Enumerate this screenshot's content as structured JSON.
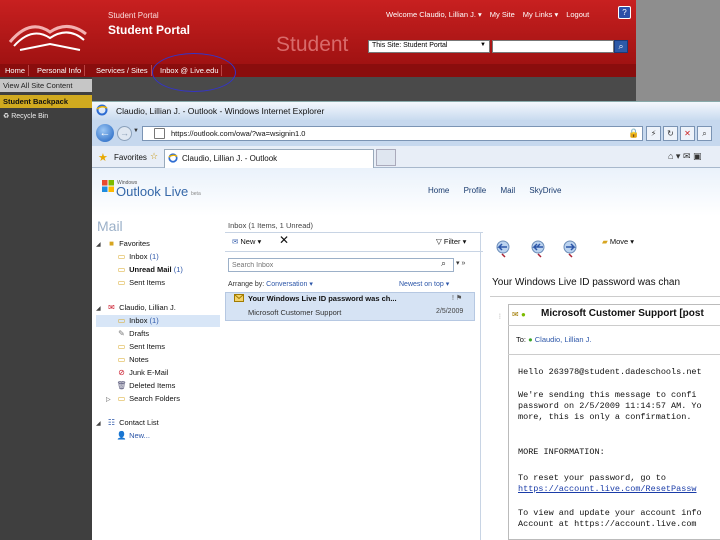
{
  "portal": {
    "small_title": "Student Portal",
    "title": "Student Portal",
    "watermark": "Student",
    "welcome": "Welcome Claudio, Lillian J. ▾",
    "my_site": "My Site",
    "my_links": "My Links ▾",
    "logout": "Logout",
    "help": "?",
    "site_select": "This Site: Student Portal",
    "nav": [
      "Home",
      "Personal Info",
      "Services / Sites",
      "Inbox @ Live.edu"
    ],
    "view_all": "View All Site Content",
    "backpack": "Student Backpack",
    "recycle": "Recycle Bin"
  },
  "ie": {
    "window_title": "Claudio, Lillian J. - Outlook - Windows Internet Explorer",
    "address": "https://outlook.com/owa/?wa=wsignin1.0",
    "favorites": "Favorites",
    "tab_title": "Claudio, Lillian J. - Outlook"
  },
  "outlook": {
    "logo_msn": "Windows",
    "logo_text": "Outlook Live",
    "logo_beta": "beta",
    "nav": [
      "Home",
      "Profile",
      "Mail",
      "SkyDrive"
    ],
    "mail_heading": "Mail",
    "folders": {
      "favorites": "Favorites",
      "fav_inbox": "Inbox",
      "fav_inbox_count": "(1)",
      "unread_mail": "Unread Mail",
      "unread_count": "(1)",
      "sent_items_fav": "Sent Items",
      "account": "Claudio, Lillian J.",
      "inbox": "Inbox",
      "inbox_count": "(1)",
      "drafts": "Drafts",
      "sent_items": "Sent Items",
      "notes": "Notes",
      "junk": "Junk E-Mail",
      "deleted": "Deleted Items",
      "search_folders": "Search Folders",
      "contacts": "Contact List",
      "new": "New..."
    },
    "list": {
      "header": "Inbox (1 Items, 1 Unread)",
      "new_label": "New ▾",
      "filter_label": "Filter ▾",
      "search_placeholder": "Search Inbox",
      "arrange_prefix": "Arrange by:",
      "arrange_value": "Conversation ▾",
      "order": "Newest on top ▾",
      "message": {
        "subject": "Your Windows Live ID password was ch...",
        "sender": "Microsoft Customer Support",
        "date": "2/5/2009"
      }
    },
    "reading": {
      "move_label": "Move ▾",
      "subject": "Your Windows Live ID password was chan",
      "from": "Microsoft Customer Support [post",
      "to_label": "To:",
      "to_name": "Claudio, Lillian J.",
      "body": [
        "Hello 263978@student.dadeschools.net",
        "We're sending this message to confi",
        "password on 2/5/2009 11:14:57 AM. Yo",
        "more, this is only a confirmation.",
        "MORE INFORMATION:",
        "To reset your password, go to",
        "https://account.live.com/ResetPassw",
        "To view and update your account info",
        "Account at https://account.live.com"
      ]
    }
  },
  "colors": {
    "portal_red": "#b51818",
    "portal_nav": "#8a0d0d",
    "backpack_gold": "#d1aa1f",
    "ie_blue": "#c6d8ee",
    "selection": "#d6e3f4",
    "link_blue": "#1a3ca8",
    "annotation_circle": "#3434c8"
  }
}
